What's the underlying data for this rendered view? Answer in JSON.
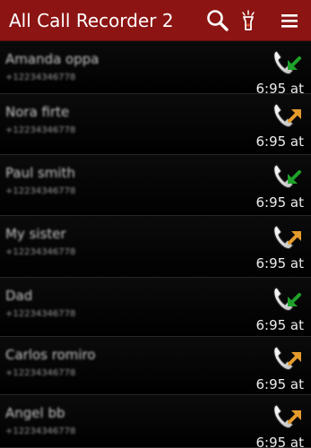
{
  "app_bar": {
    "title": "All Call Recorder 2",
    "background_color": "#8c1412",
    "icons": [
      "search-icon",
      "flashlight-icon",
      "menu-icon"
    ]
  },
  "colors": {
    "incoming_arrow": "#1fa12a",
    "outgoing_arrow": "#e59a2c"
  },
  "calls": [
    {
      "name": "Amanda oppa",
      "number": "+12234346778",
      "time": "6:95 at",
      "direction": "incoming"
    },
    {
      "name": "Nora firte",
      "number": "+12234346778",
      "time": "6:95 at",
      "direction": "outgoing"
    },
    {
      "name": "Paul smith",
      "number": "+12234346778",
      "time": "6:95 at",
      "direction": "incoming"
    },
    {
      "name": "My sister",
      "number": "+12234346778",
      "time": "6:95 at",
      "direction": "outgoing"
    },
    {
      "name": "Dad",
      "number": "+12234346778",
      "time": "6:95 at",
      "direction": "incoming"
    },
    {
      "name": "Carlos romiro",
      "number": "+12234346778",
      "time": "6:95 at",
      "direction": "outgoing"
    },
    {
      "name": "Angel bb",
      "number": "+12234346778",
      "time": "6:95 at",
      "direction": "outgoing"
    }
  ]
}
